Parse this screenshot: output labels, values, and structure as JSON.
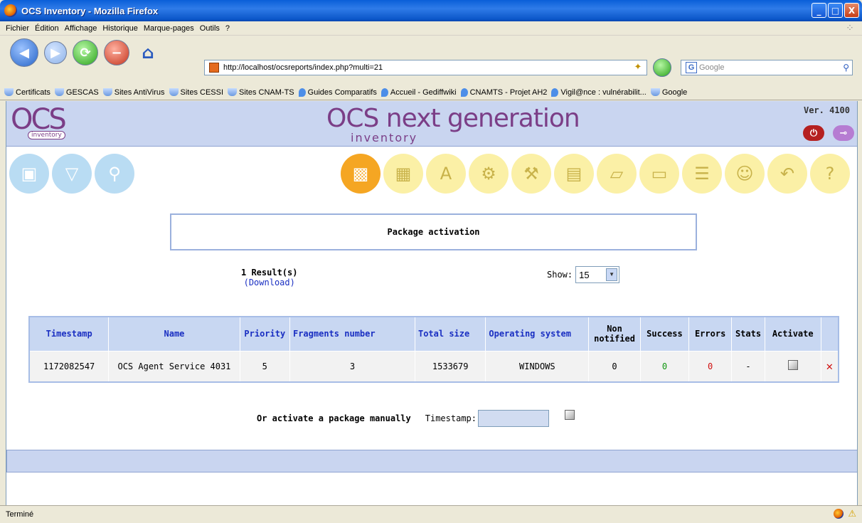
{
  "window": {
    "title": "OCS Inventory - Mozilla Firefox",
    "minimize": "_",
    "maximize": "□",
    "close": "X"
  },
  "menu": [
    "Fichier",
    "Édition",
    "Affichage",
    "Historique",
    "Marque-pages",
    "Outils",
    "?"
  ],
  "nav": {
    "url": "http://localhost/ocsreports/index.php?multi=21",
    "search_placeholder": "Google"
  },
  "bookmarks": [
    {
      "label": "Certificats",
      "icon": "folder-icon"
    },
    {
      "label": "GESCAS",
      "icon": "folder-icon"
    },
    {
      "label": "Sites AntiVirus",
      "icon": "folder-icon"
    },
    {
      "label": "Sites CESSI",
      "icon": "folder-icon"
    },
    {
      "label": "Sites CNAM-TS",
      "icon": "folder-icon"
    },
    {
      "label": "Guides Comparatifs",
      "icon": "pin-icon"
    },
    {
      "label": "Accueil - Gediffwiki",
      "icon": "pin-icon"
    },
    {
      "label": "CNAMTS - Projet AH2",
      "icon": "pin-icon"
    },
    {
      "label": "Vigil@nce : vulnérabilit...",
      "icon": "eye-icon"
    },
    {
      "label": "Google",
      "icon": "google-icon"
    }
  ],
  "header": {
    "logo_big": "OCS",
    "logo_small": "inventory",
    "title_main": "OCS next generation",
    "title_sub": "inventory",
    "version": "Ver. 4100"
  },
  "page": {
    "box_title": "Package activation",
    "results": "1 Result(s)",
    "download": "(Download)",
    "show_label": "Show:",
    "show_value": "15"
  },
  "table": {
    "headers": [
      "Timestamp",
      "Name",
      "Priority",
      "Fragments number",
      "Total size",
      "Operating system",
      "Non notified",
      "Success",
      "Errors",
      "Stats",
      "Activate",
      ""
    ],
    "rows": [
      [
        "1172082547",
        "OCS Agent Service 4031",
        "5",
        "3",
        "1533679",
        "WINDOWS",
        "0",
        "0",
        "0",
        "-",
        "",
        ""
      ]
    ]
  },
  "manual": {
    "label": "Or activate a package manually",
    "timestamp_label": "Timestamp:",
    "timestamp_value": ""
  },
  "status": {
    "text": "Terminé"
  }
}
